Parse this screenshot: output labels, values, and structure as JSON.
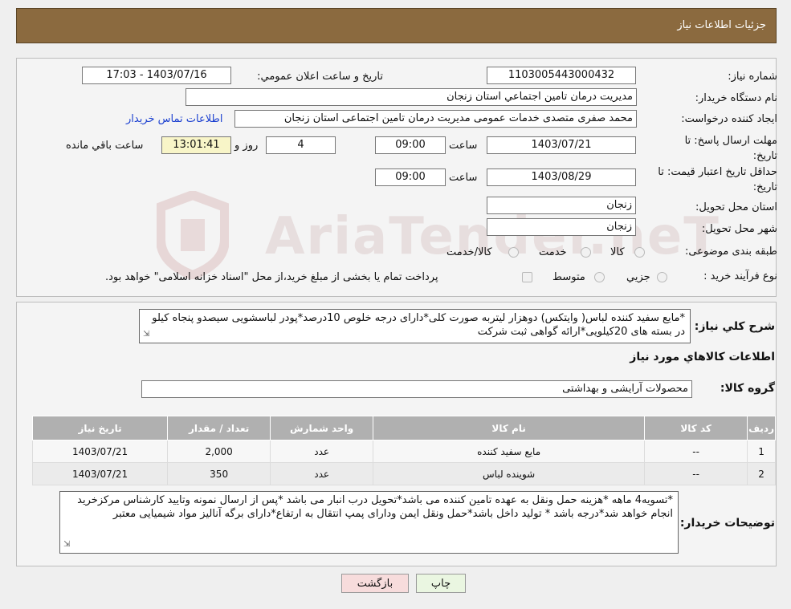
{
  "header": {
    "title": "جزئيات اطلاعات نياز"
  },
  "labels": {
    "need_number": "شماره نياز:",
    "announce_datetime": "تاريخ و ساعت اعلان عمومي:",
    "buyer_org": "نام دستگاه خريدار:",
    "requester": "ايجاد کننده درخواست:",
    "reply_deadline": "مهلت ارسال پاسخ: تا تاريخ:",
    "time": "ساعت",
    "day_and": "روز و",
    "remaining": "ساعت باقي مانده",
    "price_validity": "حداقل تاريخ اعتبار قيمت: تا تاريخ:",
    "delivery_province": "استان محل تحويل:",
    "delivery_city": "شهر محل تحويل:",
    "category": "طبقه بندی موضوعی:",
    "purchase_process": "نوع فرآيند خريد :",
    "description": "شرح کلي نياز:",
    "goods_info": "اطلاعات کالاهاي مورد نياز",
    "goods_group": "گروه کالا:",
    "buyer_notes": "توضيحات خريدار:"
  },
  "values": {
    "need_number": "1103005443000432",
    "announce_datetime": "1403/07/16 - 17:03",
    "buyer_org": "مديريت درمان تامين اجتماعي استان زنجان",
    "requester": "محمد صفری متصدی خدمات عمومی مدیریت درمان تامین اجتماعی استان زنجان",
    "buyer_contact_link": "اطلاعات تماس خريدار",
    "reply_date": "1403/07/21",
    "reply_time": "09:00",
    "reply_days": "4",
    "reply_remaining": "13:01:41",
    "validity_date": "1403/08/29",
    "validity_time": "09:00",
    "province": "زنجان",
    "city": "زنجان",
    "goods_group": "محصولات آرايشی و بهداشتی",
    "description": "*مایع سفید کننده لباس( وایتکس) دوهزار لیتربه صورت کلی*دارای درجه خلوص 10درصد*پودر لباسشویی سیصدو پنجاه کیلو در بسته های 20کیلویی*ارائه گواهی ثبت شرکت",
    "buyer_notes": "*تسویه4 ماهه *هزینه حمل ونقل به عهده تامین کننده می باشد*تحویل درب انبار می باشد *پس از ارسال نمونه وتایید کارشناس مرکزخرید انجام خواهد شد*درجه باشد * تولید داخل باشد*حمل ونقل ایمن ودارای پمپ انتقال به ارتفاع*دارای برگه آنالیز مواد شیمیایی معتبر"
  },
  "category_options": [
    {
      "label": "کالا",
      "selected": false
    },
    {
      "label": "خدمت",
      "selected": false
    },
    {
      "label": "کالا/خدمت",
      "selected": false
    }
  ],
  "process_options": [
    {
      "label": "جزيي",
      "selected": false
    },
    {
      "label": "متوسط",
      "selected": false
    }
  ],
  "process_note": "پرداخت تمام يا بخشی از مبلغ خريد،از محل \"اسناد خزانه اسلامی\" خواهد بود.",
  "table": {
    "headers": [
      "رديف",
      "کد کالا",
      "نام کالا",
      "واحد شمارش",
      "تعداد / مقدار",
      "تاريخ نياز"
    ],
    "rows": [
      [
        "1",
        "--",
        "مايع سفيد کننده",
        "عدد",
        "2,000",
        "1403/07/21"
      ],
      [
        "2",
        "--",
        "شوينده لباس",
        "عدد",
        "350",
        "1403/07/21"
      ]
    ]
  },
  "buttons": {
    "print": "چاپ",
    "back": "بازگشت"
  },
  "watermark": "AriaTender.neT"
}
